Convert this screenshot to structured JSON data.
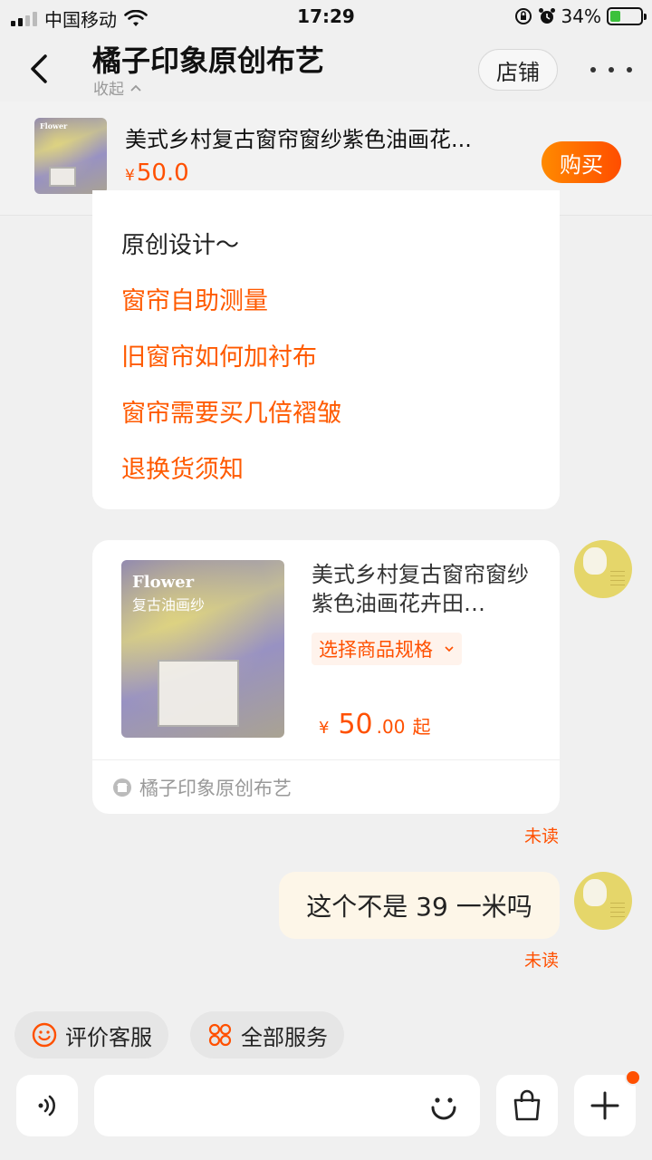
{
  "status_bar": {
    "carrier": "中国移动",
    "time": "17:29",
    "battery": "34%",
    "battery_level": 0.34
  },
  "header": {
    "title": "橘子印象原创布艺",
    "collapse_label": "收起",
    "store_label": "店铺"
  },
  "product_strip": {
    "title": "美式乡村复古窗帘窗纱紫色油画花...",
    "currency": "¥",
    "price": "50.0",
    "buy_label": "购买",
    "thumb_text": "Flower"
  },
  "links_card": {
    "intro": "原创设计～",
    "links": [
      "窗帘自助测量",
      "旧窗帘如何加衬布",
      "窗帘需要买几倍褶皱",
      "退换货须知"
    ]
  },
  "product_card": {
    "brand_text": "Flower",
    "brand_sub": "复古油画纱",
    "title": "美式乡村复古窗帘窗纱紫色油画花卉田…",
    "spec_label": "选择商品规格",
    "currency": "¥",
    "price_int": "50",
    "price_dec": ".00",
    "price_suffix": "起",
    "shop_name": "橘子印象原创布艺",
    "unread": "未读"
  },
  "message": {
    "text": "这个不是 39 一米吗",
    "unread": "未读"
  },
  "quick_services": [
    {
      "label": "评价客服",
      "icon": "smile-icon"
    },
    {
      "label": "全部服务",
      "icon": "grid-icon"
    }
  ],
  "colors": {
    "accent": "#ff5000",
    "background": "#f0f0f0",
    "bubble": "#fdf6e8"
  }
}
